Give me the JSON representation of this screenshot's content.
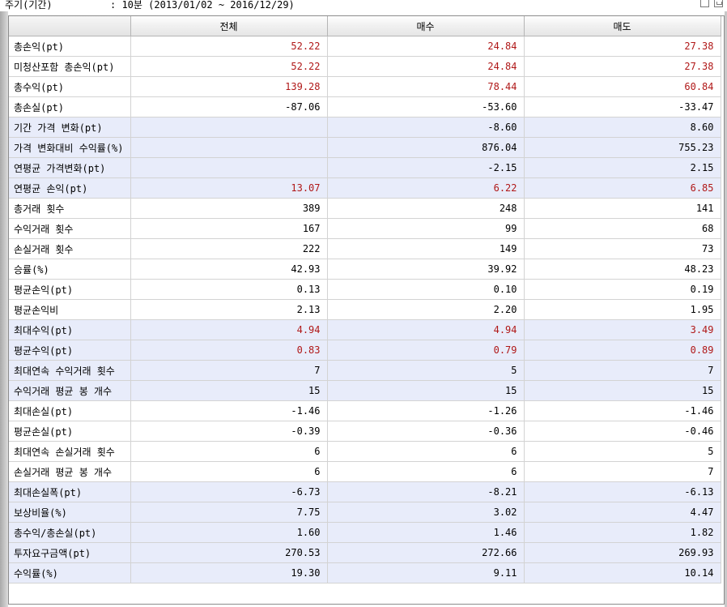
{
  "header": {
    "period_label": "주기(기간)",
    "period_value": ": 10분 (2013/01/02 ~ 2016/12/29)"
  },
  "columns": [
    "",
    "전체",
    "매수",
    "매도"
  ],
  "rows": [
    {
      "label": "총손익(pt)",
      "total": "52.22",
      "buy": "24.84",
      "sell": "27.38",
      "highlight": false,
      "red": [
        true,
        true,
        true
      ]
    },
    {
      "label": "미청산포함 총손익(pt)",
      "total": "52.22",
      "buy": "24.84",
      "sell": "27.38",
      "highlight": false,
      "red": [
        true,
        true,
        true
      ]
    },
    {
      "label": "총수익(pt)",
      "total": "139.28",
      "buy": "78.44",
      "sell": "60.84",
      "highlight": false,
      "red": [
        true,
        true,
        true
      ]
    },
    {
      "label": "총손실(pt)",
      "total": "-87.06",
      "buy": "-53.60",
      "sell": "-33.47",
      "highlight": false,
      "red": [
        false,
        false,
        false
      ]
    },
    {
      "label": "기간 가격 변화(pt)",
      "total": "",
      "buy": "-8.60",
      "sell": "8.60",
      "highlight": true,
      "red": [
        false,
        false,
        false
      ]
    },
    {
      "label": "가격 변화대비 수익률(%)",
      "total": "",
      "buy": "876.04",
      "sell": "755.23",
      "highlight": true,
      "red": [
        false,
        false,
        false
      ]
    },
    {
      "label": "연평균 가격변화(pt)",
      "total": "",
      "buy": "-2.15",
      "sell": "2.15",
      "highlight": true,
      "red": [
        false,
        false,
        false
      ]
    },
    {
      "label": "연평균 손익(pt)",
      "total": "13.07",
      "buy": "6.22",
      "sell": "6.85",
      "highlight": true,
      "red": [
        true,
        true,
        true
      ]
    },
    {
      "label": "총거래 횟수",
      "total": "389",
      "buy": "248",
      "sell": "141",
      "highlight": false,
      "red": [
        false,
        false,
        false
      ]
    },
    {
      "label": "수익거래 횟수",
      "total": "167",
      "buy": "99",
      "sell": "68",
      "highlight": false,
      "red": [
        false,
        false,
        false
      ]
    },
    {
      "label": "손실거래 횟수",
      "total": "222",
      "buy": "149",
      "sell": "73",
      "highlight": false,
      "red": [
        false,
        false,
        false
      ]
    },
    {
      "label": "승률(%)",
      "total": "42.93",
      "buy": "39.92",
      "sell": "48.23",
      "highlight": false,
      "red": [
        false,
        false,
        false
      ]
    },
    {
      "label": "평균손익(pt)",
      "total": "0.13",
      "buy": "0.10",
      "sell": "0.19",
      "highlight": false,
      "red": [
        false,
        false,
        false
      ]
    },
    {
      "label": "평균손익비",
      "total": "2.13",
      "buy": "2.20",
      "sell": "1.95",
      "highlight": false,
      "red": [
        false,
        false,
        false
      ]
    },
    {
      "label": "최대수익(pt)",
      "total": "4.94",
      "buy": "4.94",
      "sell": "3.49",
      "highlight": true,
      "red": [
        true,
        true,
        true
      ]
    },
    {
      "label": "평균수익(pt)",
      "total": "0.83",
      "buy": "0.79",
      "sell": "0.89",
      "highlight": true,
      "red": [
        true,
        true,
        true
      ]
    },
    {
      "label": "최대연속 수익거래 횟수",
      "total": "7",
      "buy": "5",
      "sell": "7",
      "highlight": true,
      "red": [
        false,
        false,
        false
      ]
    },
    {
      "label": "수익거래 평균 봉 개수",
      "total": "15",
      "buy": "15",
      "sell": "15",
      "highlight": true,
      "red": [
        false,
        false,
        false
      ]
    },
    {
      "label": "최대손실(pt)",
      "total": "-1.46",
      "buy": "-1.26",
      "sell": "-1.46",
      "highlight": false,
      "red": [
        false,
        false,
        false
      ]
    },
    {
      "label": "평균손실(pt)",
      "total": "-0.39",
      "buy": "-0.36",
      "sell": "-0.46",
      "highlight": false,
      "red": [
        false,
        false,
        false
      ]
    },
    {
      "label": "최대연속 손실거래 횟수",
      "total": "6",
      "buy": "6",
      "sell": "5",
      "highlight": false,
      "red": [
        false,
        false,
        false
      ]
    },
    {
      "label": "손실거래 평균 봉 개수",
      "total": "6",
      "buy": "6",
      "sell": "7",
      "highlight": false,
      "red": [
        false,
        false,
        false
      ]
    },
    {
      "label": "최대손실폭(pt)",
      "total": "-6.73",
      "buy": "-8.21",
      "sell": "-6.13",
      "highlight": true,
      "red": [
        false,
        false,
        false
      ]
    },
    {
      "label": "보상비율(%)",
      "total": "7.75",
      "buy": "3.02",
      "sell": "4.47",
      "highlight": true,
      "red": [
        false,
        false,
        false
      ]
    },
    {
      "label": "총수익/총손실(pt)",
      "total": "1.60",
      "buy": "1.46",
      "sell": "1.82",
      "highlight": true,
      "red": [
        false,
        false,
        false
      ]
    },
    {
      "label": "투자요구금액(pt)",
      "total": "270.53",
      "buy": "272.66",
      "sell": "269.93",
      "highlight": true,
      "red": [
        false,
        false,
        false
      ]
    },
    {
      "label": "수익률(%)",
      "total": "19.30",
      "buy": "9.11",
      "sell": "10.14",
      "highlight": true,
      "red": [
        false,
        false,
        false
      ]
    }
  ],
  "colors": {
    "highlight_row": "#e8ecfa",
    "profit_text": "#b01818"
  }
}
